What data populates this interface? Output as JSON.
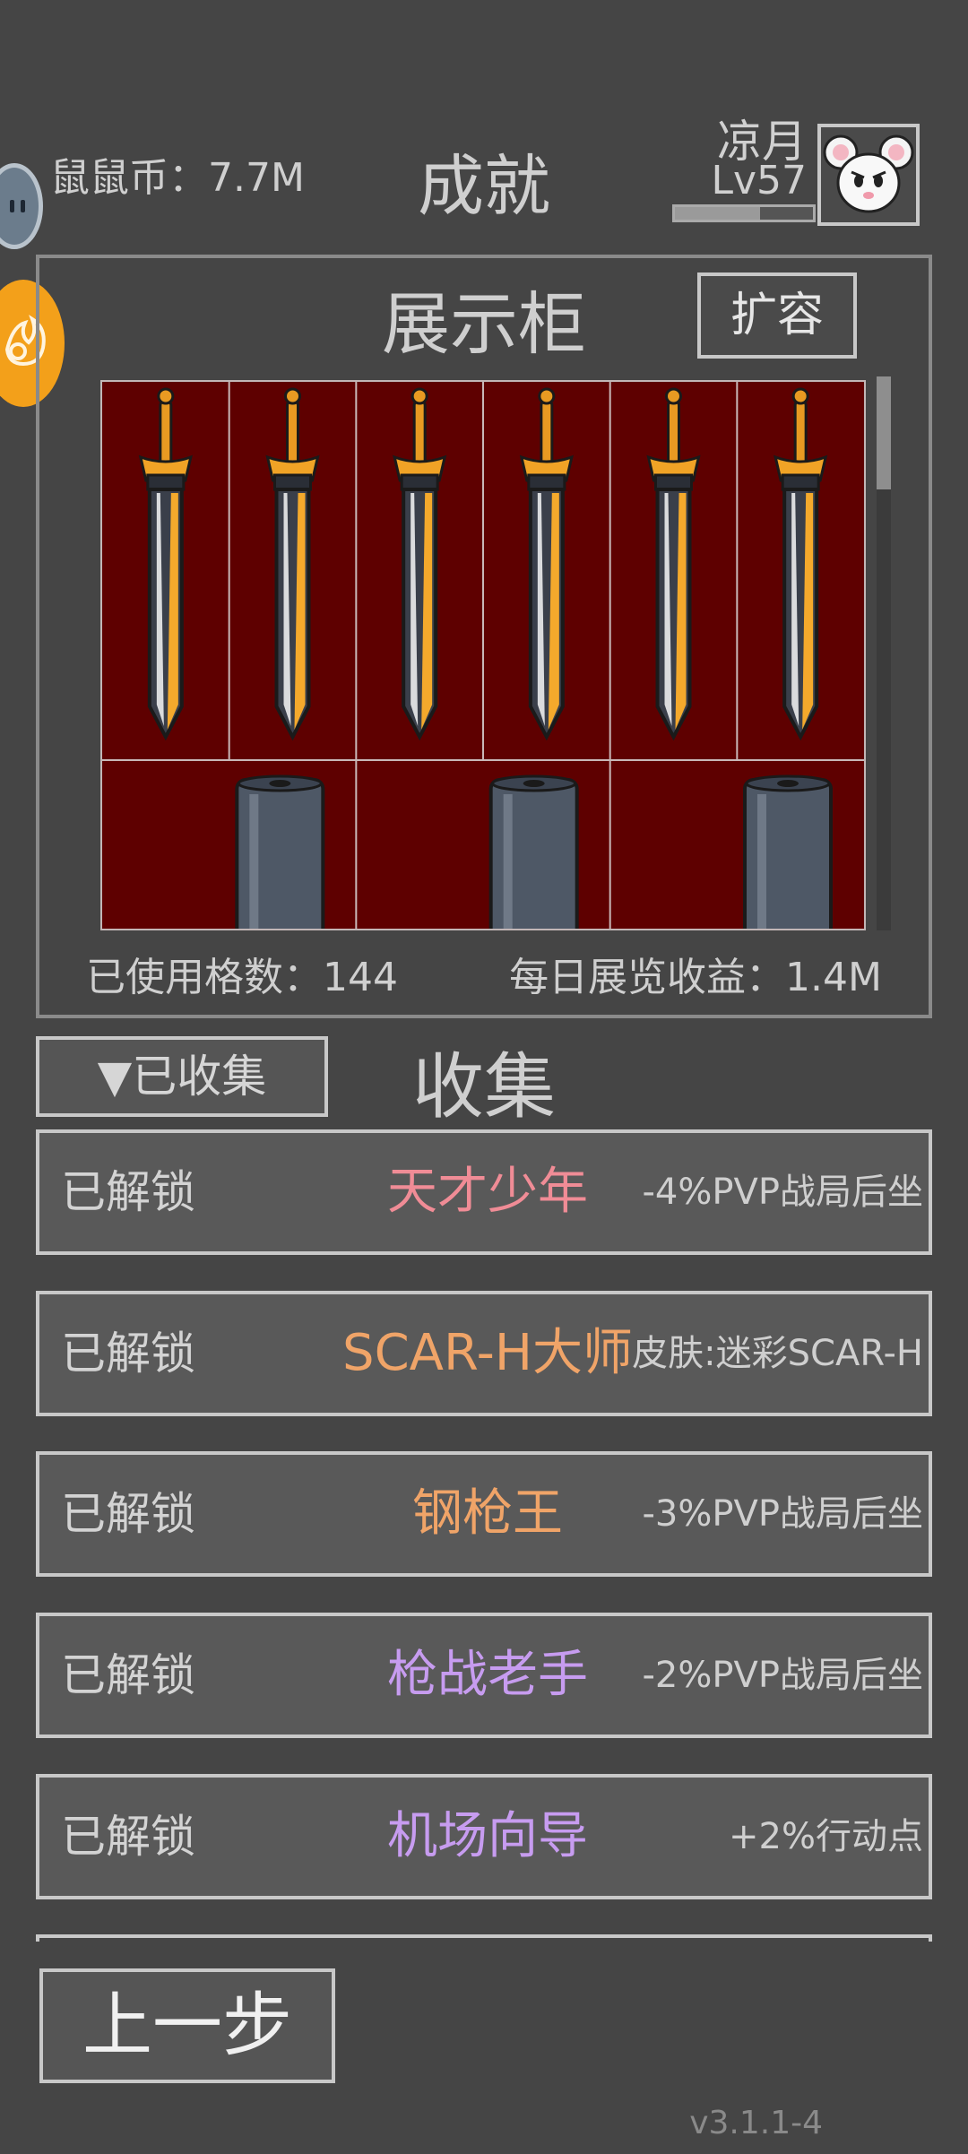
{
  "header": {
    "coins_label": "鼠鼠币：7.7M",
    "title": "成就",
    "player_name": "凉月",
    "player_level": "Lv57",
    "xp_progress": 0.62
  },
  "cabinet": {
    "title": "展示柜",
    "expand_label": "扩容",
    "used_cells_label": "已使用格数：144",
    "daily_income_label": "每日展览收益：1.4M",
    "row1_items": [
      "sword-icon",
      "sword-icon",
      "sword-icon",
      "sword-icon",
      "sword-icon",
      "sword-icon"
    ],
    "row2_items": [
      "barrel-icon",
      "barrel-icon",
      "barrel-icon"
    ]
  },
  "collection": {
    "filter_label": "▼已收集",
    "title": "收集",
    "items": [
      {
        "status": "已解锁",
        "name": "天才少年",
        "reward": "-4%PVP战局后坐",
        "color": "#f08c96"
      },
      {
        "status": "已解锁",
        "name": "SCAR-H大师",
        "reward": "皮肤:迷彩SCAR-H",
        "color": "#f0a468"
      },
      {
        "status": "已解锁",
        "name": "钢枪王",
        "reward": "-3%PVP战局后坐",
        "color": "#f0a468"
      },
      {
        "status": "已解锁",
        "name": "枪战老手",
        "reward": "-2%PVP战局后坐",
        "color": "#c79cf0"
      },
      {
        "status": "已解锁",
        "name": "机场向导",
        "reward": "+2%行动点",
        "color": "#c79cf0"
      }
    ]
  },
  "footer": {
    "back_label": "上一步",
    "version": "v3.1.1-4"
  }
}
